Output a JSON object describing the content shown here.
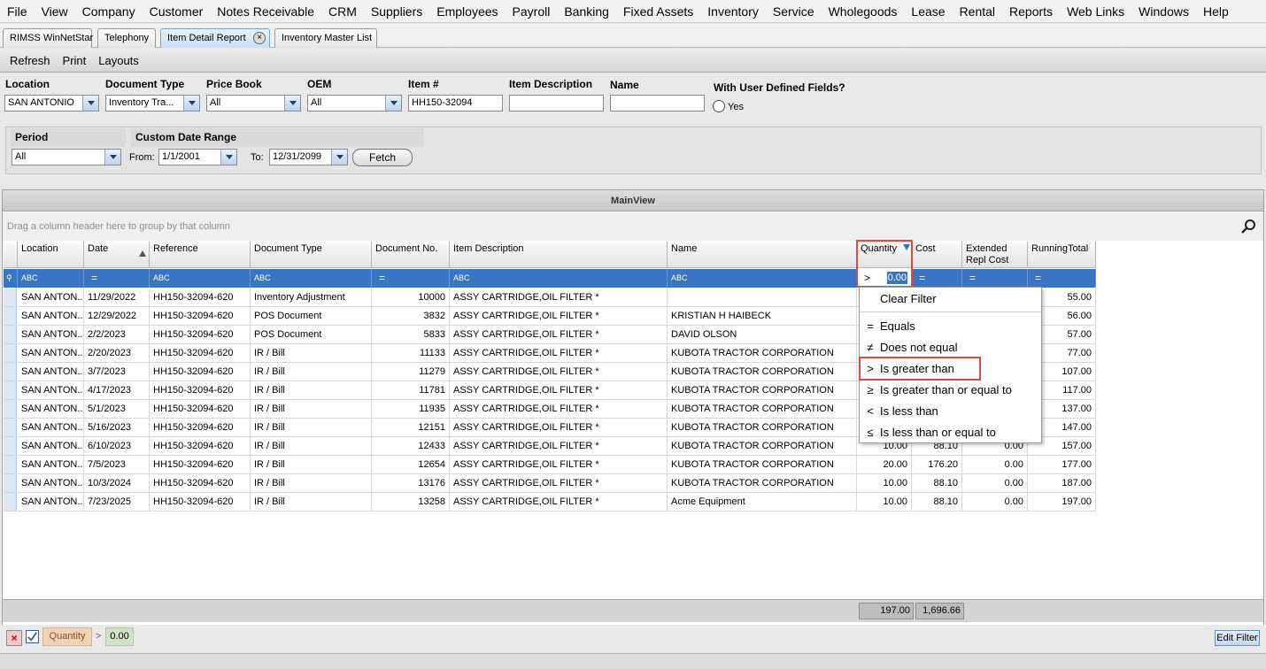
{
  "menu": [
    "File",
    "View",
    "Company",
    "Customer",
    "Notes Receivable",
    "CRM",
    "Suppliers",
    "Employees",
    "Payroll",
    "Banking",
    "Fixed Assets",
    "Inventory",
    "Service",
    "Wholegoods",
    "Lease",
    "Rental",
    "Reports",
    "Web Links",
    "Windows",
    "Help"
  ],
  "tabs": [
    {
      "label": "RIMSS WinNetStar",
      "active": false
    },
    {
      "label": "Telephony",
      "active": false
    },
    {
      "label": "Item Detail Report",
      "active": true
    },
    {
      "label": "Inventory Master List",
      "active": false
    }
  ],
  "toolbar": {
    "refresh": "Refresh",
    "print": "Print",
    "layouts": "Layouts"
  },
  "filters": {
    "location": {
      "label": "Location",
      "value": "SAN ANTONIO"
    },
    "document_type": {
      "label": "Document Type",
      "value": "Inventory Tra..."
    },
    "price_book": {
      "label": "Price Book",
      "value": "All"
    },
    "oem": {
      "label": "OEM",
      "value": "All"
    },
    "item_no": {
      "label": "Item #",
      "value": "HH150-32094"
    },
    "item_description": {
      "label": "Item Description",
      "value": ""
    },
    "name": {
      "label": "Name",
      "value": ""
    },
    "udf": {
      "label": "With User Defined Fields?",
      "option": "Yes"
    },
    "period": {
      "label": "Period",
      "value": "All"
    },
    "custom_range": {
      "label": "Custom Date Range",
      "from_label": "From:",
      "from": "1/1/2001",
      "to_label": "To:",
      "to": "12/31/2099"
    },
    "fetch": "Fetch"
  },
  "mainview": {
    "title": "MainView",
    "group_hint": "Drag a column header here to group by that column",
    "columns": [
      "Location",
      "Date",
      "Reference",
      "Document Type",
      "Document No.",
      "Item Description",
      "Name",
      "Quantity",
      "Cost",
      "Extended Repl Cost",
      "RunningTotal"
    ],
    "filter_row": {
      "text_marker": "ABC",
      "eq_marker": "=",
      "quantity_op": ">",
      "quantity_value": "0.00"
    },
    "rows": [
      [
        "SAN ANTON...",
        "11/29/2022",
        "HH150-32094-620",
        "Inventory Adjustment",
        "10000",
        "ASSY CARTRIDGE,OIL FILTER   *",
        "",
        "",
        "",
        "",
        "55.00"
      ],
      [
        "SAN ANTON...",
        "12/29/2022",
        "HH150-32094-620",
        "POS Document",
        "3832",
        "ASSY CARTRIDGE,OIL FILTER   *",
        "KRISTIAN H HAIBECK",
        "",
        "",
        "",
        "56.00"
      ],
      [
        "SAN ANTON...",
        "2/2/2023",
        "HH150-32094-620",
        "POS Document",
        "5833",
        "ASSY CARTRIDGE,OIL FILTER   *",
        "DAVID OLSON",
        "",
        "",
        "",
        "57.00"
      ],
      [
        "SAN ANTON...",
        "2/20/2023",
        "HH150-32094-620",
        "IR / Bill",
        "11133",
        "ASSY CARTRIDGE,OIL FILTER   *",
        "KUBOTA TRACTOR CORPORATION",
        "",
        "",
        "",
        "77.00"
      ],
      [
        "SAN ANTON...",
        "3/7/2023",
        "HH150-32094-620",
        "IR / Bill",
        "11279",
        "ASSY CARTRIDGE,OIL FILTER   *",
        "KUBOTA TRACTOR CORPORATION",
        "",
        "",
        "",
        "107.00"
      ],
      [
        "SAN ANTON...",
        "4/17/2023",
        "HH150-32094-620",
        "IR / Bill",
        "11781",
        "ASSY CARTRIDGE,OIL FILTER   *",
        "KUBOTA TRACTOR CORPORATION",
        "",
        "",
        "",
        "117.00"
      ],
      [
        "SAN ANTON...",
        "5/1/2023",
        "HH150-32094-620",
        "IR / Bill",
        "11935",
        "ASSY CARTRIDGE,OIL FILTER   *",
        "KUBOTA TRACTOR CORPORATION",
        "",
        "",
        "",
        "137.00"
      ],
      [
        "SAN ANTON...",
        "5/16/2023",
        "HH150-32094-620",
        "IR / Bill",
        "12151",
        "ASSY CARTRIDGE,OIL FILTER   *",
        "KUBOTA TRACTOR CORPORATION",
        "",
        "",
        "",
        "147.00"
      ],
      [
        "SAN ANTON...",
        "6/10/2023",
        "HH150-32094-620",
        "IR / Bill",
        "12433",
        "ASSY CARTRIDGE,OIL FILTER   *",
        "KUBOTA TRACTOR CORPORATION",
        "10.00",
        "88.10",
        "0.00",
        "157.00"
      ],
      [
        "SAN ANTON...",
        "7/5/2023",
        "HH150-32094-620",
        "IR / Bill",
        "12654",
        "ASSY CARTRIDGE,OIL FILTER   *",
        "KUBOTA TRACTOR CORPORATION",
        "20.00",
        "176.20",
        "0.00",
        "177.00"
      ],
      [
        "SAN ANTON...",
        "10/3/2024",
        "HH150-32094-620",
        "IR / Bill",
        "13176",
        "ASSY CARTRIDGE,OIL FILTER   *",
        "KUBOTA TRACTOR CORPORATION",
        "10.00",
        "88.10",
        "0.00",
        "187.00"
      ],
      [
        "SAN ANTON...",
        "7/23/2025",
        "HH150-32094-620",
        "IR / Bill",
        "13258",
        "ASSY CARTRIDGE,OIL FILTER   *",
        "Acme Equipment",
        "10.00",
        "88.10",
        "0.00",
        "197.00"
      ]
    ],
    "totals": {
      "quantity": "197.00",
      "cost": "1,696.66"
    }
  },
  "filter_menu": {
    "items": [
      {
        "symbol": "",
        "label": "Clear Filter"
      },
      {
        "symbol": "=",
        "label": "Equals"
      },
      {
        "symbol": "≠",
        "label": "Does not equal"
      },
      {
        "symbol": ">",
        "label": "Is greater than"
      },
      {
        "symbol": "≥",
        "label": "Is greater than or equal to"
      },
      {
        "symbol": "<",
        "label": "Is less than"
      },
      {
        "symbol": "≤",
        "label": "Is less than or equal to"
      }
    ]
  },
  "status_filter": {
    "field": "Quantity",
    "op": ">",
    "value": "0.00",
    "edit_filter": "Edit Filter"
  },
  "colors": {
    "accent": "#3a75c4",
    "highlight": "#e04a3a",
    "tab_active": "#c9e0f5"
  }
}
